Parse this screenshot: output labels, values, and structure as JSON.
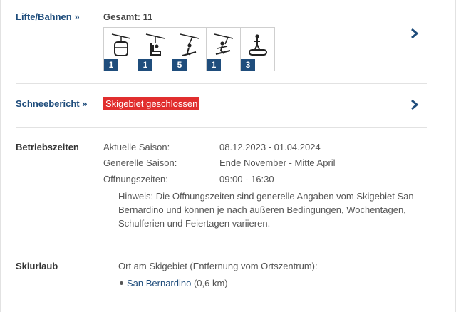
{
  "lifts": {
    "label": "Lifte/Bahnen »",
    "total": "Gesamt: 11",
    "types": [
      {
        "icon": "gondola-icon",
        "count": "1"
      },
      {
        "icon": "chairlift-icon",
        "count": "1"
      },
      {
        "icon": "t-bar-lift-icon",
        "count": "5"
      },
      {
        "icon": "platter-lift-icon",
        "count": "1"
      },
      {
        "icon": "magic-carpet-icon",
        "count": "3"
      }
    ]
  },
  "snow": {
    "label": "Schneebericht »",
    "status": "Skigebiet geschlossen",
    "status_color": "#e12e2e"
  },
  "hours": {
    "label": "Betriebszeiten",
    "rows": [
      {
        "key": "Aktuelle Saison:",
        "value": "08.12.2023 - 01.04.2024"
      },
      {
        "key": "Generelle Saison:",
        "value": "Ende November - Mitte April"
      },
      {
        "key": "Öffnungszeiten:",
        "value": "09:00 - 16:30"
      }
    ],
    "hint": "Hinweis: Die Öffnungszeiten sind generelle Angaben vom Skigebiet San Bernardino und können je nach äußeren Bedingungen, Wochentagen, Schulferien und Feiertagen variieren."
  },
  "vacation": {
    "label": "Skiurlaub",
    "intro": "Ort am Skigebiet (Entfernung vom Ortszentrum):",
    "place": "San Bernardino",
    "distance": "(0,6 km)"
  },
  "colors": {
    "link": "#1f4d7c",
    "accent": "#1f4d7c",
    "badge": "#e12e2e"
  }
}
